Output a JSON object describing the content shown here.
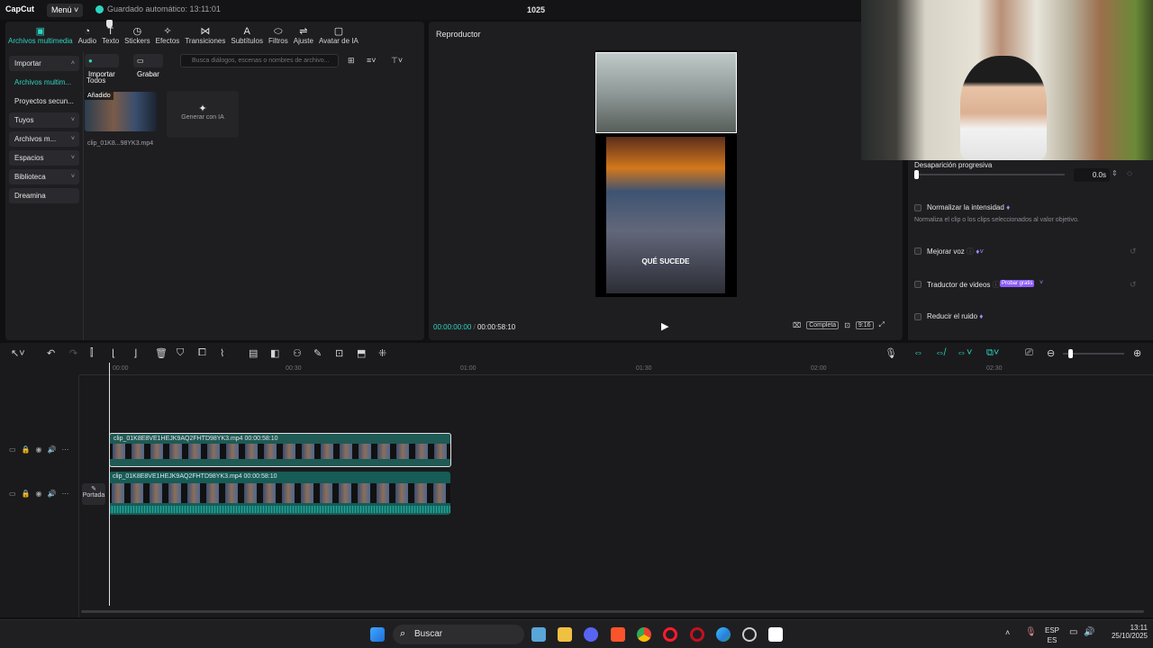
{
  "app": {
    "logo": "CapCut",
    "menu_label": "Menú",
    "autosave": "Guardado automático: 13:11:01",
    "project_title": "1025"
  },
  "media_tabs": [
    {
      "label": "Archivos multimedia",
      "icon": "media-icon"
    },
    {
      "label": "Audio",
      "icon": "audio-icon"
    },
    {
      "label": "Texto",
      "icon": "text-icon"
    },
    {
      "label": "Stickers",
      "icon": "sticker-icon"
    },
    {
      "label": "Efectos",
      "icon": "effects-icon"
    },
    {
      "label": "Transiciones",
      "icon": "transitions-icon"
    },
    {
      "label": "Subtítulos",
      "icon": "subtitles-icon"
    },
    {
      "label": "Filtros",
      "icon": "filters-icon"
    },
    {
      "label": "Ajuste",
      "icon": "adjust-icon"
    },
    {
      "label": "Avatar de IA",
      "icon": "avatar-icon"
    }
  ],
  "sidenav": {
    "importar": "Importar",
    "archivos": "Archivos multim...",
    "proyectos": "Proyectos secun...",
    "tuyos": "Tuyos",
    "archivos_m": "Archivos m...",
    "espacios": "Espacios",
    "biblioteca": "Biblioteca",
    "dreamina": "Dreamina"
  },
  "media": {
    "import_btn": "Importar",
    "record_btn": "Grabar",
    "search_placeholder": "Busca diálogos, escenas o nombres de archivo...",
    "section": "Todos",
    "clip_tag": "Añadido",
    "clip_name": "clip_01K8...98YK3.mp4",
    "generate_label": "Generar con IA"
  },
  "player": {
    "title": "Reproductor",
    "subtitle_text": "QUÉ SUCEDE",
    "current_time": "00:00:00:00",
    "duration": "00:00:58:10",
    "complete_label": "Completa",
    "ratio_label": "9:16"
  },
  "right_panel": {
    "fade_label": "Desaparición progresiva",
    "fade_value": "0.0s",
    "normalize_label": "Normalizar la intensidad",
    "normalize_desc": "Normaliza el clip o los clips seleccionados al valor objetivo.",
    "improve_voice": "Mejorar voz",
    "translate_label": "Traductor de videos",
    "try_free": "Probar gratis",
    "reduce_noise": "Reducir el ruido"
  },
  "timeline": {
    "ruler": [
      "00:00",
      "00:30",
      "01:00",
      "01:30",
      "02:00",
      "02:30"
    ],
    "clip1_label": "clip_01K8E8VE1HEJK9AQ2FHTD98YK3.mp4   00:00:58:10",
    "clip2_label": "clip_01K8E8VE1HEJK9AQ2FHTD98YK3.mp4   00:00:58:10",
    "cover_label": "Portada"
  },
  "taskbar": {
    "search": "Buscar",
    "lang_top": "ESP",
    "lang_bottom": "ES",
    "time": "13:11",
    "date": "25/10/2025"
  }
}
